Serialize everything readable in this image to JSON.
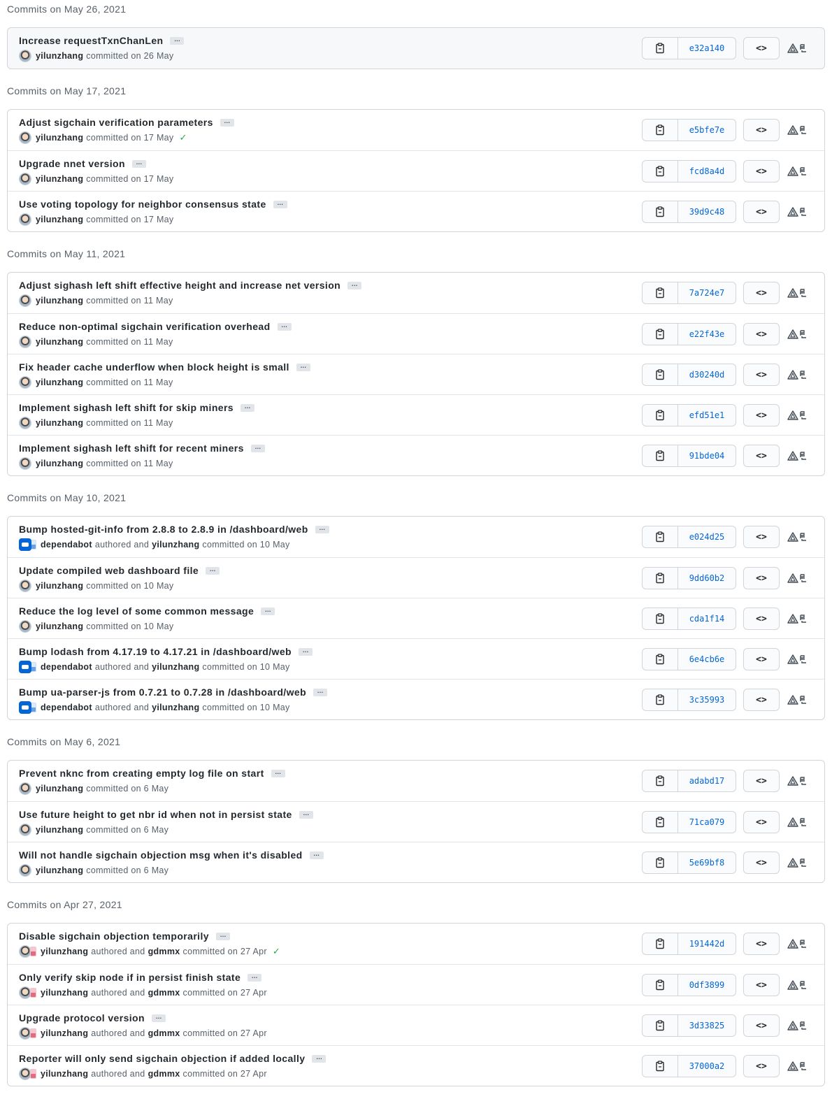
{
  "days": [
    {
      "heading": "Commits on May 26, 2021",
      "commits": [
        {
          "title": "Increase requestTxnChanLen",
          "author": "yilunzhang",
          "coauthor": "",
          "verb": "committed on 26 May",
          "sha": "e32a140",
          "verified": false,
          "avatar": "user"
        }
      ]
    },
    {
      "heading": "Commits on May 17, 2021",
      "commits": [
        {
          "title": "Adjust sigchain verification parameters",
          "author": "yilunzhang",
          "coauthor": "",
          "verb": "committed on 17 May",
          "sha": "e5bfe7e",
          "verified": true,
          "avatar": "user"
        },
        {
          "title": "Upgrade nnet version",
          "author": "yilunzhang",
          "coauthor": "",
          "verb": "committed on 17 May",
          "sha": "fcd8a4d",
          "verified": false,
          "avatar": "user"
        },
        {
          "title": "Use voting topology for neighbor consensus state",
          "author": "yilunzhang",
          "coauthor": "",
          "verb": "committed on 17 May",
          "sha": "39d9c48",
          "verified": false,
          "avatar": "user"
        }
      ]
    },
    {
      "heading": "Commits on May 11, 2021",
      "commits": [
        {
          "title": "Adjust sighash left shift effective height and increase net version",
          "author": "yilunzhang",
          "coauthor": "",
          "verb": "committed on 11 May",
          "sha": "7a724e7",
          "verified": false,
          "avatar": "user"
        },
        {
          "title": "Reduce non-optimal sigchain verification overhead",
          "author": "yilunzhang",
          "coauthor": "",
          "verb": "committed on 11 May",
          "sha": "e22f43e",
          "verified": false,
          "avatar": "user"
        },
        {
          "title": "Fix header cache underflow when block height is small",
          "author": "yilunzhang",
          "coauthor": "",
          "verb": "committed on 11 May",
          "sha": "d30240d",
          "verified": false,
          "avatar": "user"
        },
        {
          "title": "Implement sighash left shift for skip miners",
          "author": "yilunzhang",
          "coauthor": "",
          "verb": "committed on 11 May",
          "sha": "efd51e1",
          "verified": false,
          "avatar": "user"
        },
        {
          "title": "Implement sighash left shift for recent miners",
          "author": "yilunzhang",
          "coauthor": "",
          "verb": "committed on 11 May",
          "sha": "91bde04",
          "verified": false,
          "avatar": "user"
        }
      ]
    },
    {
      "heading": "Commits on May 10, 2021",
      "commits": [
        {
          "title": "Bump hosted-git-info from 2.8.8 to 2.8.9 in /dashboard/web",
          "author": "dependabot",
          "coauthor": "yilunzhang",
          "verb": "committed on 10 May",
          "sha": "e024d25",
          "verified": false,
          "avatar": "bot"
        },
        {
          "title": "Update compiled web dashboard file",
          "author": "yilunzhang",
          "coauthor": "",
          "verb": "committed on 10 May",
          "sha": "9dd60b2",
          "verified": false,
          "avatar": "user"
        },
        {
          "title": "Reduce the log level of some common message",
          "author": "yilunzhang",
          "coauthor": "",
          "verb": "committed on 10 May",
          "sha": "cda1f14",
          "verified": false,
          "avatar": "user"
        },
        {
          "title": "Bump lodash from 4.17.19 to 4.17.21 in /dashboard/web",
          "author": "dependabot",
          "coauthor": "yilunzhang",
          "verb": "committed on 10 May",
          "sha": "6e4cb6e",
          "verified": false,
          "avatar": "bot"
        },
        {
          "title": "Bump ua-parser-js from 0.7.21 to 0.7.28 in /dashboard/web",
          "author": "dependabot",
          "coauthor": "yilunzhang",
          "verb": "committed on 10 May",
          "sha": "3c35993",
          "verified": false,
          "avatar": "bot"
        }
      ]
    },
    {
      "heading": "Commits on May 6, 2021",
      "commits": [
        {
          "title": "Prevent nknc from creating empty log file on start",
          "author": "yilunzhang",
          "coauthor": "",
          "verb": "committed on 6 May",
          "sha": "adabd17",
          "verified": false,
          "avatar": "user"
        },
        {
          "title": "Use future height to get nbr id when not in persist state",
          "author": "yilunzhang",
          "coauthor": "",
          "verb": "committed on 6 May",
          "sha": "71ca079",
          "verified": false,
          "avatar": "user"
        },
        {
          "title": "Will not handle sigchain objection msg when it's disabled",
          "author": "yilunzhang",
          "coauthor": "",
          "verb": "committed on 6 May",
          "sha": "5e69bf8",
          "verified": false,
          "avatar": "user"
        }
      ]
    },
    {
      "heading": "Commits on Apr 27, 2021",
      "commits": [
        {
          "title": "Disable sigchain objection temporarily",
          "author": "yilunzhang",
          "coauthor": "gdmmx",
          "verb": "committed on 27 Apr",
          "sha": "191442d",
          "verified": true,
          "avatar": "pair"
        },
        {
          "title": "Only verify skip node if in persist finish state",
          "author": "yilunzhang",
          "coauthor": "gdmmx",
          "verb": "committed on 27 Apr",
          "sha": "0df3899",
          "verified": false,
          "avatar": "pair"
        },
        {
          "title": "Upgrade protocol version",
          "author": "yilunzhang",
          "coauthor": "gdmmx",
          "verb": "committed on 27 Apr",
          "sha": "3d33825",
          "verified": false,
          "avatar": "pair"
        },
        {
          "title": "Reporter will only send sigchain objection if added locally",
          "author": "yilunzhang",
          "coauthor": "gdmmx",
          "verb": "committed on 27 Apr",
          "sha": "37000a2",
          "verified": false,
          "avatar": "pair"
        }
      ]
    }
  ],
  "labels": {
    "authored_and": "authored and",
    "ellipsis": "…",
    "browse_symbol": "<>"
  },
  "icons": {
    "copy": "clipboard-icon",
    "browse": "code-icon",
    "verified": "check-icon",
    "extra": "triangle-icon"
  },
  "colors": {
    "sha_link": "#0366d6",
    "verified_check": "#28a745",
    "border": "#d1d5da"
  }
}
